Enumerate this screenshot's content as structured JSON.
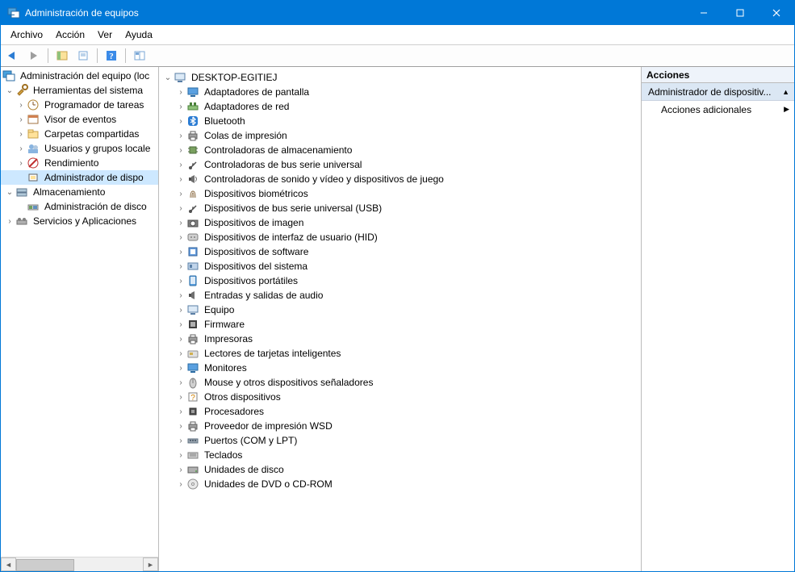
{
  "titlebar": {
    "title": "Administración de equipos"
  },
  "menu": {
    "file": "Archivo",
    "action": "Acción",
    "view": "Ver",
    "help": "Ayuda"
  },
  "left_tree": {
    "root": "Administración del equipo (loc",
    "tools": "Herramientas del sistema",
    "scheduler": "Programador de tareas",
    "eventviewer": "Visor de eventos",
    "sharedfolders": "Carpetas compartidas",
    "usersgroups": "Usuarios y grupos locale",
    "performance": "Rendimiento",
    "devmgr": "Administrador de dispo",
    "storage": "Almacenamiento",
    "diskmgmt": "Administración de disco",
    "services": "Servicios y Aplicaciones"
  },
  "device_root": "DESKTOP-EGITIEJ",
  "devices": [
    {
      "id": "display-adapters",
      "label": "Adaptadores de pantalla",
      "icon": "monitor"
    },
    {
      "id": "network-adapters",
      "label": "Adaptadores de red",
      "icon": "net"
    },
    {
      "id": "bluetooth",
      "label": "Bluetooth",
      "icon": "bt"
    },
    {
      "id": "print-queues",
      "label": "Colas de impresión",
      "icon": "printer"
    },
    {
      "id": "storage-controllers",
      "label": "Controladoras de almacenamiento",
      "icon": "chip"
    },
    {
      "id": "usb-controllers",
      "label": "Controladoras de bus serie universal",
      "icon": "usb"
    },
    {
      "id": "sound-video-game",
      "label": "Controladoras de sonido y vídeo y dispositivos de juego",
      "icon": "speaker"
    },
    {
      "id": "biometric",
      "label": "Dispositivos biométricos",
      "icon": "finger"
    },
    {
      "id": "usb-devices",
      "label": "Dispositivos de bus serie universal (USB)",
      "icon": "usb"
    },
    {
      "id": "imaging",
      "label": "Dispositivos de imagen",
      "icon": "camera"
    },
    {
      "id": "hid",
      "label": "Dispositivos de interfaz de usuario (HID)",
      "icon": "hid"
    },
    {
      "id": "software-devices",
      "label": "Dispositivos de software",
      "icon": "soft"
    },
    {
      "id": "system-devices",
      "label": "Dispositivos del sistema",
      "icon": "sys"
    },
    {
      "id": "portable",
      "label": "Dispositivos portátiles",
      "icon": "tablet"
    },
    {
      "id": "audio-io",
      "label": "Entradas y salidas de audio",
      "icon": "audio"
    },
    {
      "id": "computer",
      "label": "Equipo",
      "icon": "pc"
    },
    {
      "id": "firmware",
      "label": "Firmware",
      "icon": "fw"
    },
    {
      "id": "printers",
      "label": "Impresoras",
      "icon": "printer"
    },
    {
      "id": "smartcard",
      "label": "Lectores de tarjetas inteligentes",
      "icon": "card"
    },
    {
      "id": "monitors",
      "label": "Monitores",
      "icon": "monitor"
    },
    {
      "id": "mice",
      "label": "Mouse y otros dispositivos señaladores",
      "icon": "mouse"
    },
    {
      "id": "other",
      "label": "Otros dispositivos",
      "icon": "other"
    },
    {
      "id": "processors",
      "label": "Procesadores",
      "icon": "cpu"
    },
    {
      "id": "wsd-print",
      "label": "Proveedor de impresión WSD",
      "icon": "printer"
    },
    {
      "id": "ports",
      "label": "Puertos (COM y LPT)",
      "icon": "port"
    },
    {
      "id": "keyboards",
      "label": "Teclados",
      "icon": "kbd"
    },
    {
      "id": "disks",
      "label": "Unidades de disco",
      "icon": "hdd"
    },
    {
      "id": "dvd",
      "label": "Unidades de DVD o CD-ROM",
      "icon": "cd"
    }
  ],
  "right": {
    "header": "Acciones",
    "sub": "Administrador de dispositiv...",
    "more": "Acciones adicionales"
  }
}
